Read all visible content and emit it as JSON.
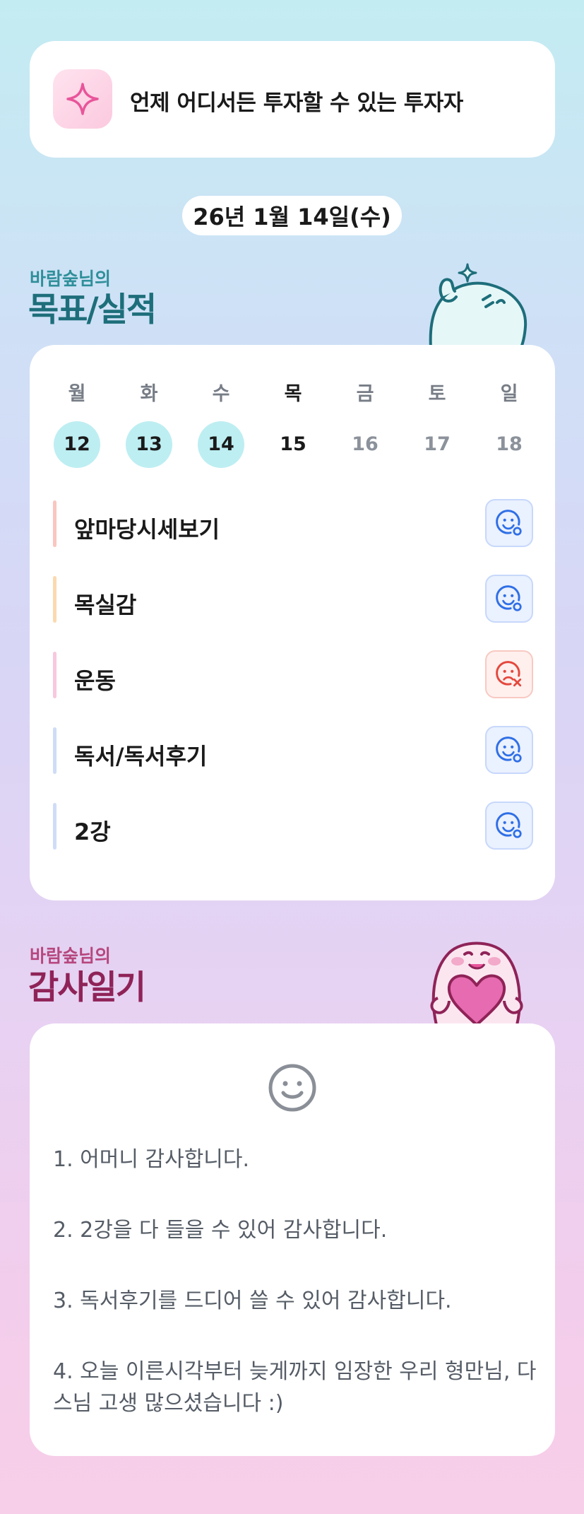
{
  "banner": {
    "text": "언제 어디서든 투자할 수 있는 투자자",
    "icon": "sparkle-icon",
    "accent": "#e8559a"
  },
  "date": "26년 1월 14일(수)",
  "goals_section": {
    "subtitle": "바람숲님의",
    "title": "목표/실적",
    "week": [
      {
        "day": "월",
        "date": "12",
        "done": true
      },
      {
        "day": "화",
        "date": "13",
        "done": true
      },
      {
        "day": "수",
        "date": "14",
        "done": true
      },
      {
        "day": "목",
        "date": "15",
        "done": false,
        "today": true
      },
      {
        "day": "금",
        "date": "16",
        "done": false
      },
      {
        "day": "토",
        "date": "17",
        "done": false
      },
      {
        "day": "일",
        "date": "18",
        "done": false
      }
    ],
    "items": [
      {
        "label": "앞마당시세보기",
        "status": "achieved",
        "bar_color": "#f9c6c0"
      },
      {
        "label": "목실감",
        "status": "achieved",
        "bar_color": "#fbd9b0"
      },
      {
        "label": "운동",
        "status": "failed",
        "bar_color": "#f7c8de"
      },
      {
        "label": "독서/독서후기",
        "status": "achieved",
        "bar_color": "#cfdcf6"
      },
      {
        "label": "2강",
        "status": "achieved",
        "bar_color": "#d0dcf7"
      }
    ],
    "status_colors": {
      "achieved": "#2f6fe6",
      "failed": "#e4483d"
    }
  },
  "gratitude_section": {
    "subtitle": "바람숲님의",
    "title": "감사일기",
    "face_icon": "smile-face-icon",
    "entries": [
      "1. 어머니 감사합니다.",
      "2. 2강을 다 들을 수 있어 감사합니다.",
      "3. 독서후기를 드디어 쓸 수 있어 감사합니다.",
      "4. 오늘 이른시각부터 늦게까지 임장한 우리 형만님, 다스님 고생 많으셨습니다 :)"
    ]
  }
}
